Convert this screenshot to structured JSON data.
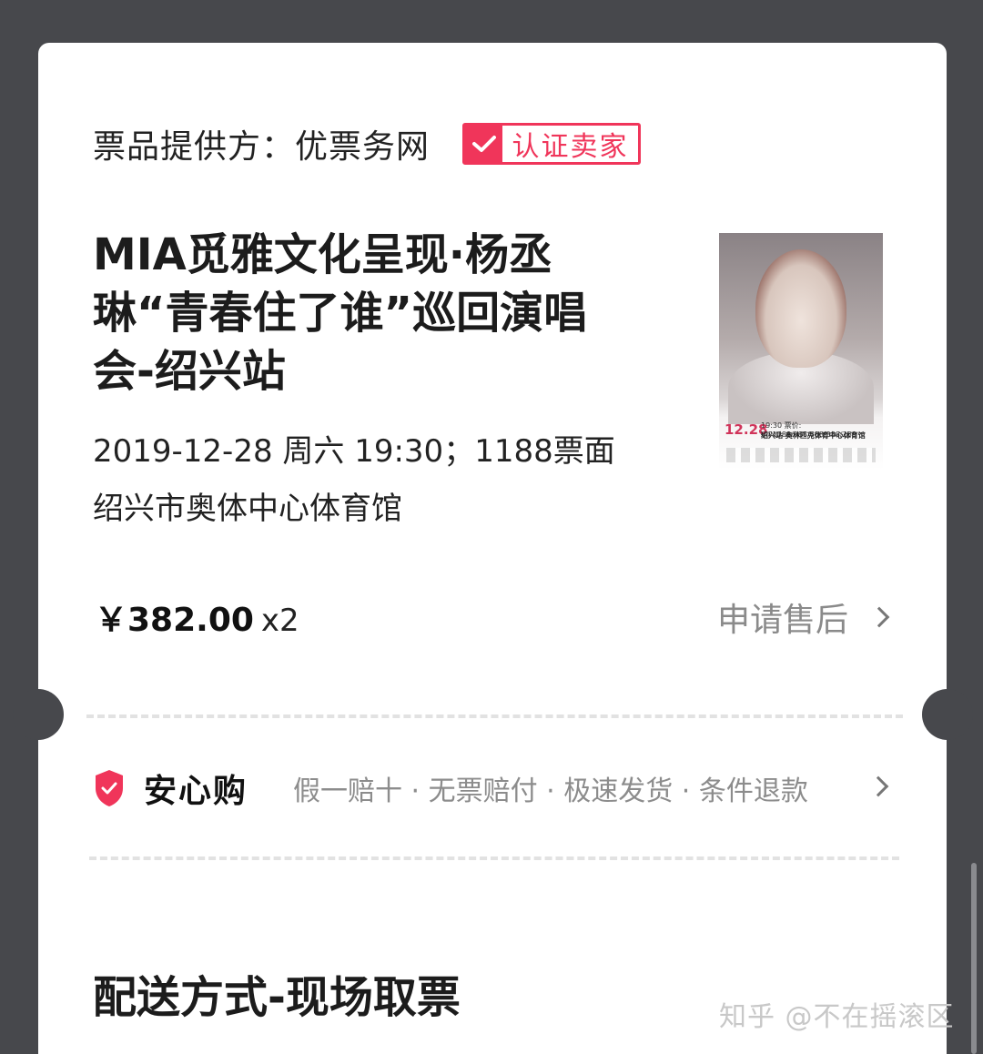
{
  "provider": {
    "text": "票品提供方：优票务网",
    "badge": "认证卖家"
  },
  "event": {
    "title": "MIA觅雅文化呈现·杨丞琳“青春住了谁”巡回演唱会-绍兴站",
    "datetime": "2019-12-28 周六 19:30；1188票面",
    "venue": "绍兴市奥体中心体育馆",
    "poster": {
      "date": "12.28",
      "line1": "19:30 票价: VIP1188/988/688/388/288",
      "line2": "绍兴站 奥林匹克体育中心体育馆"
    }
  },
  "order": {
    "price": "￥382.00",
    "quantity": "x2",
    "aftersale_label": "申请售后"
  },
  "guarantee": {
    "title": "安心购",
    "items": "假一赔十 · 无票赔付 · 极速发货 · 条件退款"
  },
  "delivery": {
    "title": "配送方式-现场取票"
  },
  "watermark": "知乎 @不在摇滚区",
  "colors": {
    "accent": "#f0355a",
    "background": "#47484c",
    "card": "#ffffff"
  }
}
